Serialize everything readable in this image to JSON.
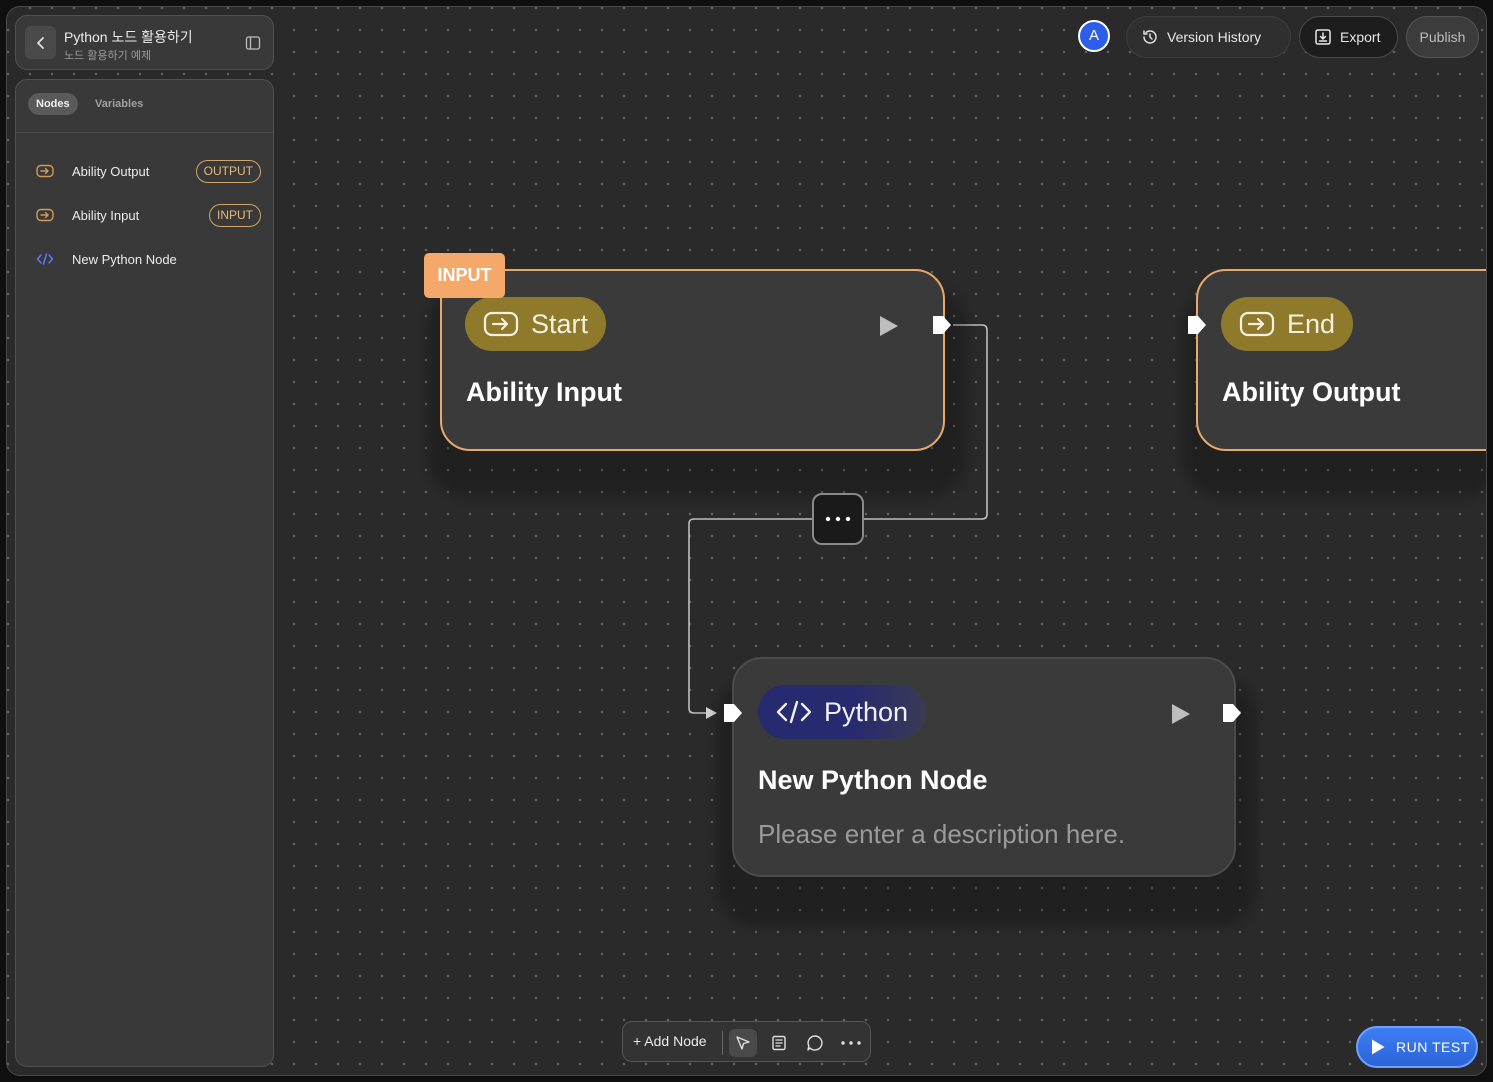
{
  "header": {
    "title": "Python 노드 활용하기",
    "subtitle": "노드 활용하기 예제"
  },
  "sidebar": {
    "tabs": [
      {
        "label": "Nodes",
        "active": true
      },
      {
        "label": "Variables",
        "active": false
      }
    ],
    "items": [
      {
        "label": "Ability Output",
        "badge": "OUTPUT",
        "icon": "io-arrow-icon"
      },
      {
        "label": "Ability Input",
        "badge": "INPUT",
        "icon": "io-arrow-icon"
      },
      {
        "label": "New Python Node",
        "badge": "",
        "icon": "code-icon"
      }
    ]
  },
  "topbar": {
    "avatar": "A",
    "version_history": "Version History",
    "export": "Export",
    "publish": "Publish"
  },
  "canvas": {
    "input_tag": "INPUT",
    "nodes": [
      {
        "id": "start",
        "pill": "Start",
        "title": "Ability Input"
      },
      {
        "id": "end",
        "pill": "End",
        "title": "Ability Output"
      },
      {
        "id": "python",
        "pill": "Python",
        "title": "New Python Node",
        "description": "Please enter a description here."
      }
    ]
  },
  "bottom_toolbar": {
    "add_node": "+ Add Node"
  },
  "run_test": "RUN TEST",
  "colors": {
    "io_border": "#e7a96a",
    "io_pill": "#8f7a2c",
    "python_pill": "#262a6e",
    "accent_blue": "#2c64d6"
  }
}
